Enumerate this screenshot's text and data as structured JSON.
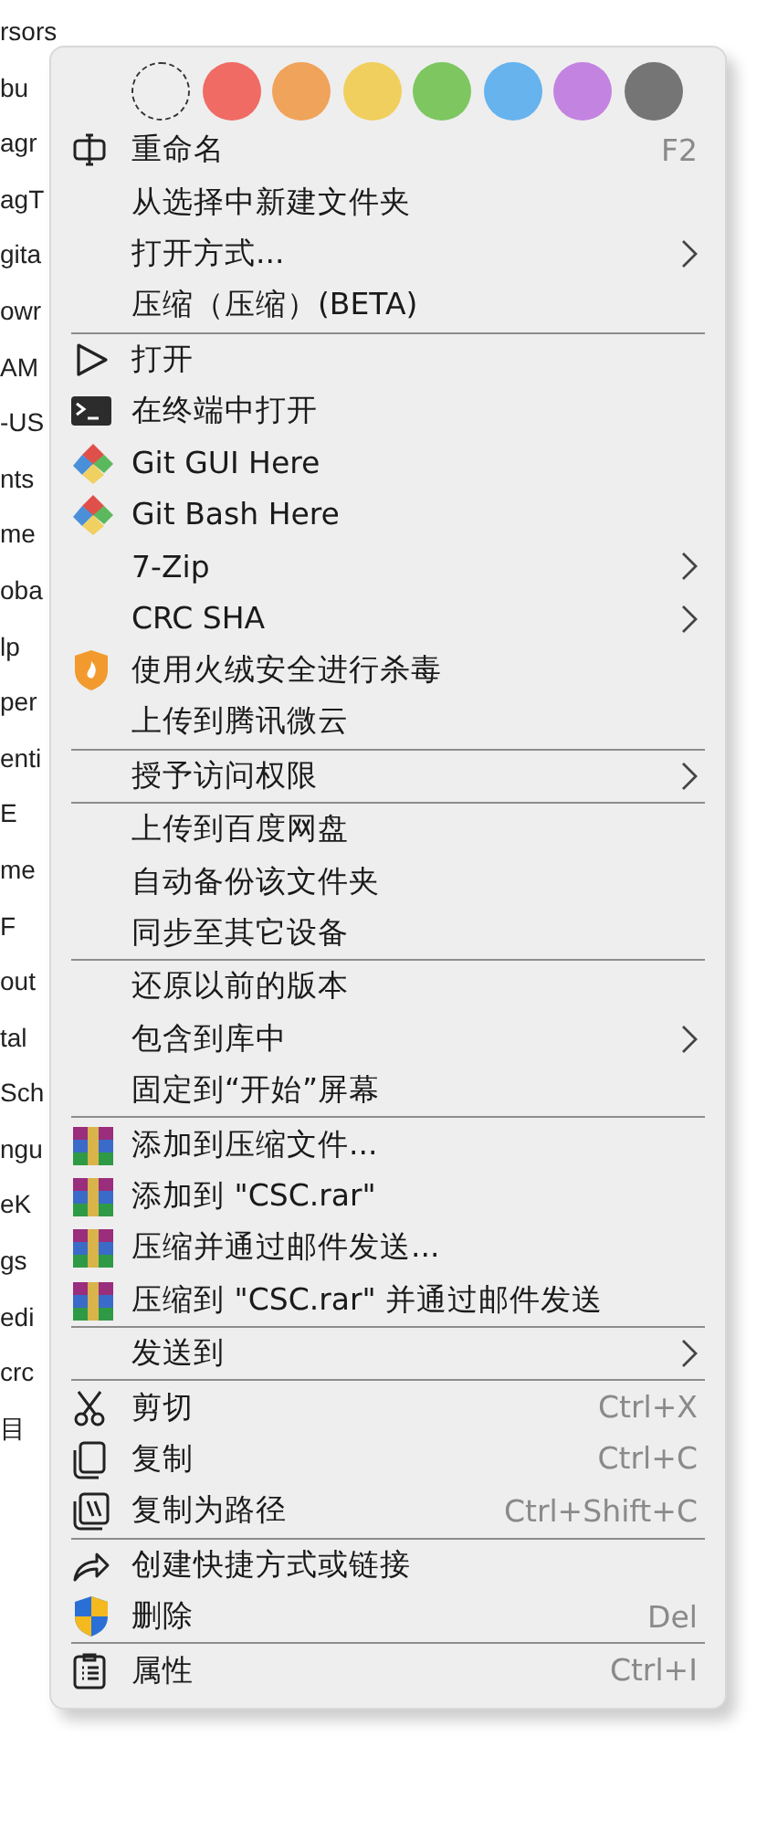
{
  "background": {
    "items": [
      "rsors",
      "bu",
      "agr",
      "agT",
      "gita",
      "owr",
      "AM",
      "-US",
      "nts",
      "me",
      "oba",
      "lp",
      "per",
      "enti",
      "E",
      "me",
      "F",
      "out",
      "tal",
      "Sch",
      "ngu",
      "eK",
      "gs",
      "edi",
      "crc",
      "目"
    ]
  },
  "menu": {
    "color_tags": [
      {
        "kind": "none"
      },
      {
        "kind": "color",
        "color": "#ef6b63"
      },
      {
        "kind": "color",
        "color": "#f0a35a"
      },
      {
        "kind": "color",
        "color": "#f1cf5e"
      },
      {
        "kind": "color",
        "color": "#7dc660"
      },
      {
        "kind": "color",
        "color": "#66b3ee"
      },
      {
        "kind": "color",
        "color": "#c383e0"
      },
      {
        "kind": "color",
        "color": "#757575"
      }
    ],
    "sections": [
      [
        {
          "kind": "rename",
          "label": "重命名",
          "shortcut": "F2",
          "submenu": false
        },
        {
          "kind": "plain",
          "label": "从选择中新建文件夹",
          "submenu": false
        },
        {
          "kind": "plain",
          "label": "打开方式...",
          "submenu": true
        },
        {
          "kind": "plain",
          "label": "压缩（压缩）(BETA)",
          "submenu": false
        }
      ],
      [
        {
          "kind": "play",
          "label": "打开",
          "submenu": false
        },
        {
          "kind": "terminal",
          "label": "在终端中打开",
          "submenu": false
        },
        {
          "kind": "git",
          "label": "Git GUI Here",
          "submenu": false
        },
        {
          "kind": "git",
          "label": "Git Bash Here",
          "submenu": false
        },
        {
          "kind": "plain",
          "label": "7-Zip",
          "submenu": true
        },
        {
          "kind": "plain",
          "label": "CRC SHA",
          "submenu": true
        },
        {
          "kind": "antivirus",
          "label": "使用火绒安全进行杀毒",
          "submenu": false
        },
        {
          "kind": "plain",
          "label": "上传到腾讯微云",
          "submenu": false
        }
      ],
      [
        {
          "kind": "plain",
          "label": "授予访问权限",
          "submenu": true
        }
      ],
      [
        {
          "kind": "plain",
          "label": "上传到百度网盘",
          "submenu": false
        },
        {
          "kind": "plain",
          "label": "自动备份该文件夹",
          "submenu": false
        },
        {
          "kind": "plain",
          "label": "同步至其它设备",
          "submenu": false
        }
      ],
      [
        {
          "kind": "plain",
          "label": "还原以前的版本",
          "submenu": false
        },
        {
          "kind": "plain",
          "label": "包含到库中",
          "submenu": true
        },
        {
          "kind": "plain",
          "label": "固定到“开始”屏幕",
          "submenu": false
        }
      ],
      [
        {
          "kind": "archive",
          "label": "添加到压缩文件...",
          "submenu": false
        },
        {
          "kind": "archive",
          "label": "添加到 \"CSC.rar\"",
          "submenu": false
        },
        {
          "kind": "archive",
          "label": "压缩并通过邮件发送...",
          "submenu": false
        },
        {
          "kind": "archive",
          "label": "压缩到 \"CSC.rar\" 并通过邮件发送",
          "submenu": false
        }
      ],
      [
        {
          "kind": "plain",
          "label": "发送到",
          "submenu": true
        }
      ],
      [
        {
          "kind": "cut",
          "label": "剪切",
          "shortcut": "Ctrl+X",
          "submenu": false
        },
        {
          "kind": "copy",
          "label": "复制",
          "shortcut": "Ctrl+C",
          "submenu": false
        },
        {
          "kind": "copypath",
          "label": "复制为路径",
          "shortcut": "Ctrl+Shift+C",
          "submenu": false
        }
      ],
      [
        {
          "kind": "share",
          "label": "创建快捷方式或链接",
          "submenu": false
        },
        {
          "kind": "shield",
          "label": "删除",
          "shortcut": "Del",
          "submenu": false
        }
      ],
      [
        {
          "kind": "props",
          "label": "属性",
          "shortcut": "Ctrl+I",
          "submenu": false
        }
      ]
    ]
  }
}
